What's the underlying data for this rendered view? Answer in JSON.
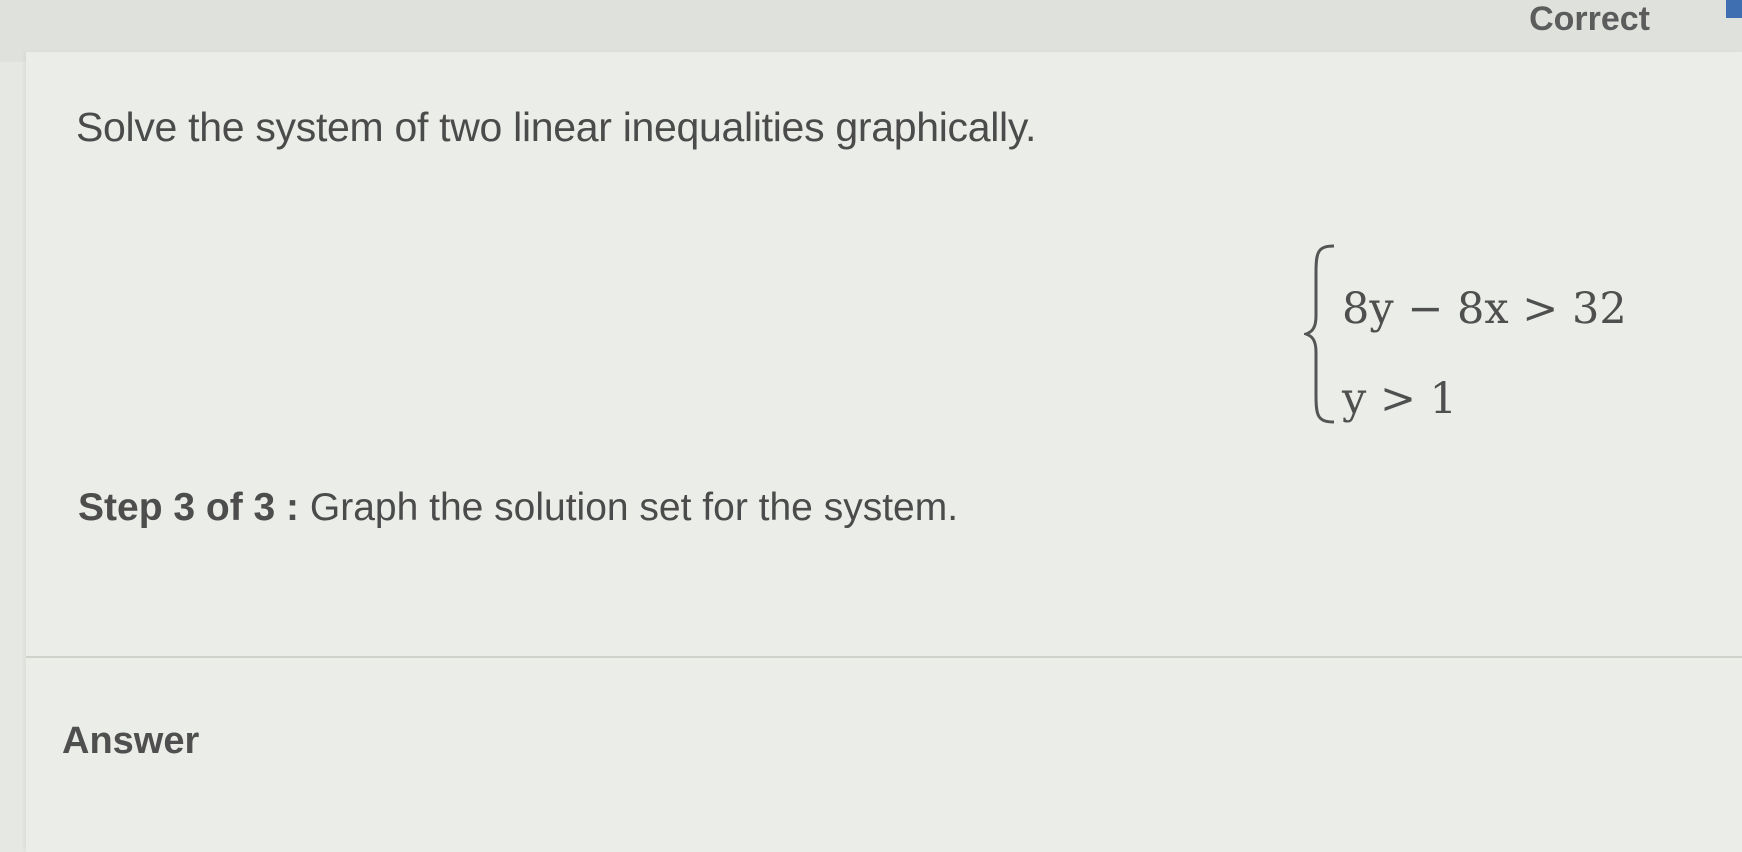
{
  "status": {
    "label": "Correct"
  },
  "question": {
    "prompt": "Solve the system of two linear inequalities graphically."
  },
  "system": {
    "inequalities": [
      "8y − 8x > 32",
      "y > 1"
    ]
  },
  "step": {
    "label": "Step 3 of 3 :",
    "instruction": "Graph the solution set for the system."
  },
  "answer": {
    "heading": "Answer"
  },
  "colors": {
    "status_marker": "#3f6fb0"
  }
}
